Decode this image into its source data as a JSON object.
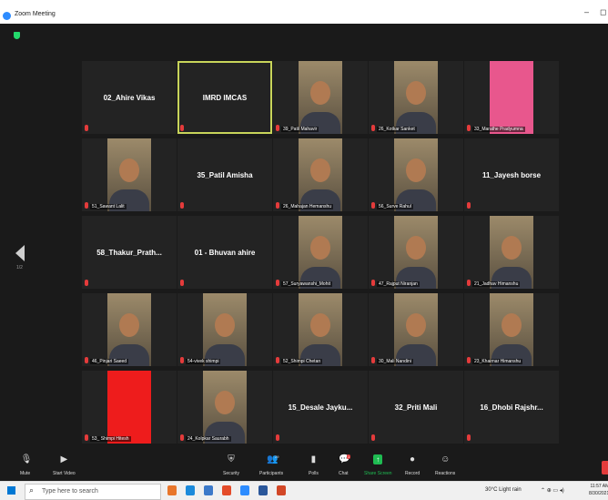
{
  "window": {
    "title": "Zoom Meeting",
    "minimize": "–",
    "restore": "◻"
  },
  "gallery": {
    "page_indicator": "1/2"
  },
  "tiles": [
    {
      "type": "text",
      "big": "02_Ahire Vikas"
    },
    {
      "type": "text",
      "big": "IMRD IMCAS",
      "active": true
    },
    {
      "type": "video",
      "name": "39_Patil Mahavir"
    },
    {
      "type": "video",
      "name": "26_Kotkar Sanket"
    },
    {
      "type": "solid",
      "color": "#e8578d",
      "name": "33_Marathe Pradyumna"
    },
    {
      "type": "video",
      "name": "51_Sawant Lalit"
    },
    {
      "type": "text",
      "big": "35_Patil Amisha"
    },
    {
      "type": "video",
      "name": "26_Mahajan Hemanshu"
    },
    {
      "type": "video",
      "name": "56_Surve Rahul"
    },
    {
      "type": "text",
      "big": "11_Jayesh borse"
    },
    {
      "type": "text",
      "big": "58_Thakur_Prath..."
    },
    {
      "type": "text",
      "big": "01 - Bhuvan ahire"
    },
    {
      "type": "video",
      "name": "57_Suryawanshi_Mohit"
    },
    {
      "type": "video",
      "name": "47_Rajput Niranjan"
    },
    {
      "type": "video",
      "name": "21_Jadhav Himanshu"
    },
    {
      "type": "video",
      "name": "46_Pinjari Saeed"
    },
    {
      "type": "video",
      "name": "54-vivek shimpi"
    },
    {
      "type": "video",
      "name": "52_Shimpi Chetan"
    },
    {
      "type": "video",
      "name": "30_Mali Nandini"
    },
    {
      "type": "video",
      "name": "23_Khairnar Himanshu"
    },
    {
      "type": "solid",
      "color": "#ee1c1c",
      "name": "53_ Shimpi Hitesh"
    },
    {
      "type": "video",
      "name": "24_Kolpkar Saurabh"
    },
    {
      "type": "text",
      "big": "15_Desale Jayku..."
    },
    {
      "type": "text",
      "big": "32_Priti Mali"
    },
    {
      "type": "text",
      "big": "16_Dhobi Rajshr..."
    }
  ],
  "toolbar": {
    "mute": "Mute",
    "start_video": "Start Video",
    "security": "Security",
    "participants": "Participants",
    "participants_count": "29",
    "polls": "Polls",
    "chat": "Chat",
    "chat_badge": "1",
    "share_screen": "Share Screen",
    "record": "Record",
    "reactions": "Reactions"
  },
  "taskbar": {
    "search_placeholder": "Type here to search",
    "weather": "30°C  Light rain",
    "time": "11:57 AM",
    "date": "8/30/2021"
  },
  "colors": {
    "accent_green": "#1fbc52",
    "active_speaker": "#c8d45a",
    "mic_muted": "#e43b3b"
  }
}
